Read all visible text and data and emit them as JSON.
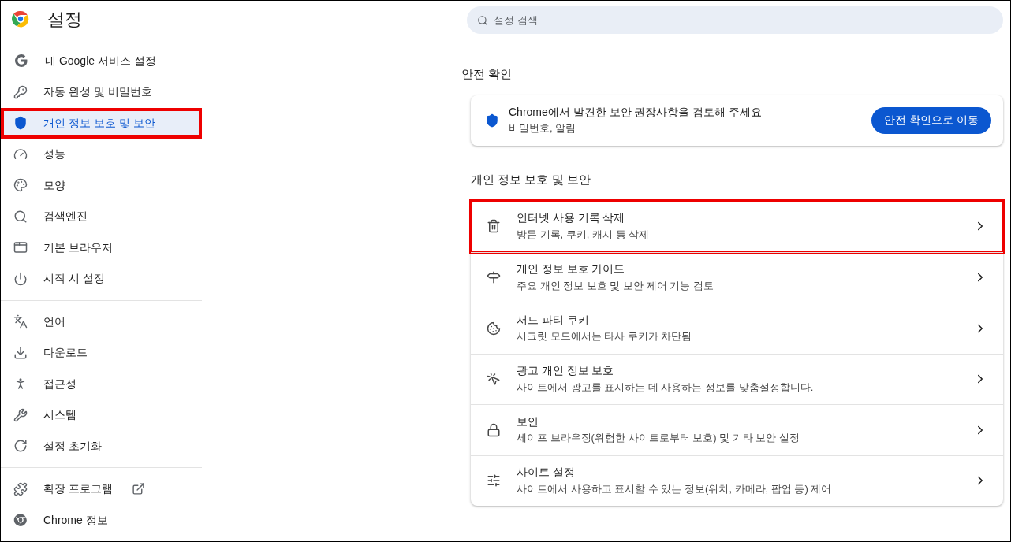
{
  "header": {
    "title": "설정"
  },
  "search": {
    "placeholder": "설정 검색"
  },
  "sidebar": {
    "groups": [
      {
        "items": [
          {
            "kind": "google",
            "label": "내 Google 서비스 설정",
            "selected": false,
            "highlighted": false
          },
          {
            "kind": "key",
            "label": "자동 완성 및 비밀번호",
            "selected": false,
            "highlighted": false
          },
          {
            "kind": "shield",
            "label": "개인 정보 보호 및 보안",
            "selected": true,
            "highlighted": true
          },
          {
            "kind": "gauge",
            "label": "성능",
            "selected": false,
            "highlighted": false
          },
          {
            "kind": "palette",
            "label": "모양",
            "selected": false,
            "highlighted": false
          },
          {
            "kind": "search",
            "label": "검색엔진",
            "selected": false,
            "highlighted": false
          },
          {
            "kind": "browser",
            "label": "기본 브라우저",
            "selected": false,
            "highlighted": false
          },
          {
            "kind": "power",
            "label": "시작 시 설정",
            "selected": false,
            "highlighted": false
          }
        ]
      },
      {
        "items": [
          {
            "kind": "language",
            "label": "언어",
            "selected": false,
            "highlighted": false
          },
          {
            "kind": "download",
            "label": "다운로드",
            "selected": false,
            "highlighted": false
          },
          {
            "kind": "accessibility",
            "label": "접근성",
            "selected": false,
            "highlighted": false
          },
          {
            "kind": "wrench",
            "label": "시스템",
            "selected": false,
            "highlighted": false
          },
          {
            "kind": "reset",
            "label": "설정 초기화",
            "selected": false,
            "highlighted": false
          }
        ]
      },
      {
        "items": [
          {
            "kind": "puzzle",
            "label": "확장 프로그램",
            "selected": false,
            "highlighted": false,
            "external": true
          },
          {
            "kind": "chrome",
            "label": "Chrome 정보",
            "selected": false,
            "highlighted": false
          }
        ]
      }
    ]
  },
  "safety_check": {
    "heading": "안전 확인",
    "title": "Chrome에서 발견한 보안 권장사항을 검토해 주세요",
    "subtitle": "비밀번호, 알림",
    "button": "안전 확인으로 이동"
  },
  "privacy": {
    "heading": "개인 정보 보호 및 보안",
    "rows": [
      {
        "kind": "trash",
        "title": "인터넷 사용 기록 삭제",
        "subtitle": "방문 기록, 쿠키, 캐시 등 삭제",
        "highlighted": true
      },
      {
        "kind": "guide",
        "title": "개인 정보 보호 가이드",
        "subtitle": "주요 개인 정보 보호 및 보안 제어 기능 검토",
        "highlighted": false
      },
      {
        "kind": "cookie",
        "title": "서드 파티 쿠키",
        "subtitle": "시크릿 모드에서는 타사 쿠키가 차단됨",
        "highlighted": false
      },
      {
        "kind": "ads",
        "title": "광고 개인 정보 보호",
        "subtitle": "사이트에서 광고를 표시하는 데 사용하는 정보를 맞춤설정합니다.",
        "highlighted": false
      },
      {
        "kind": "lock",
        "title": "보안",
        "subtitle": "세이프 브라우징(위험한 사이트로부터 보호) 및 기타 보안 설정",
        "highlighted": false
      },
      {
        "kind": "sliders",
        "title": "사이트 설정",
        "subtitle": "사이트에서 사용하고 표시할 수 있는 정보(위치, 카메라, 팝업 등) 제어",
        "highlighted": false
      }
    ]
  }
}
